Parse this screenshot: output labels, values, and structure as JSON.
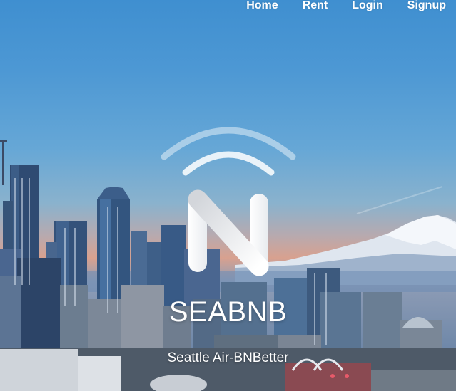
{
  "nav": {
    "items": [
      {
        "label": "Home"
      },
      {
        "label": "Rent"
      },
      {
        "label": "Login"
      },
      {
        "label": "Signup"
      }
    ]
  },
  "hero": {
    "title": "SEABNB",
    "tagline": "Seattle Air-BNBetter",
    "logo_icon": "n-wifi-logo-icon",
    "background": "seattle-skyline-with-mount-rainier",
    "colors": {
      "sky_top": "#3f8fd0",
      "horizon_glow": "#d8a18f",
      "mountain": "#e6ecf3",
      "text": "#ffffff"
    }
  }
}
